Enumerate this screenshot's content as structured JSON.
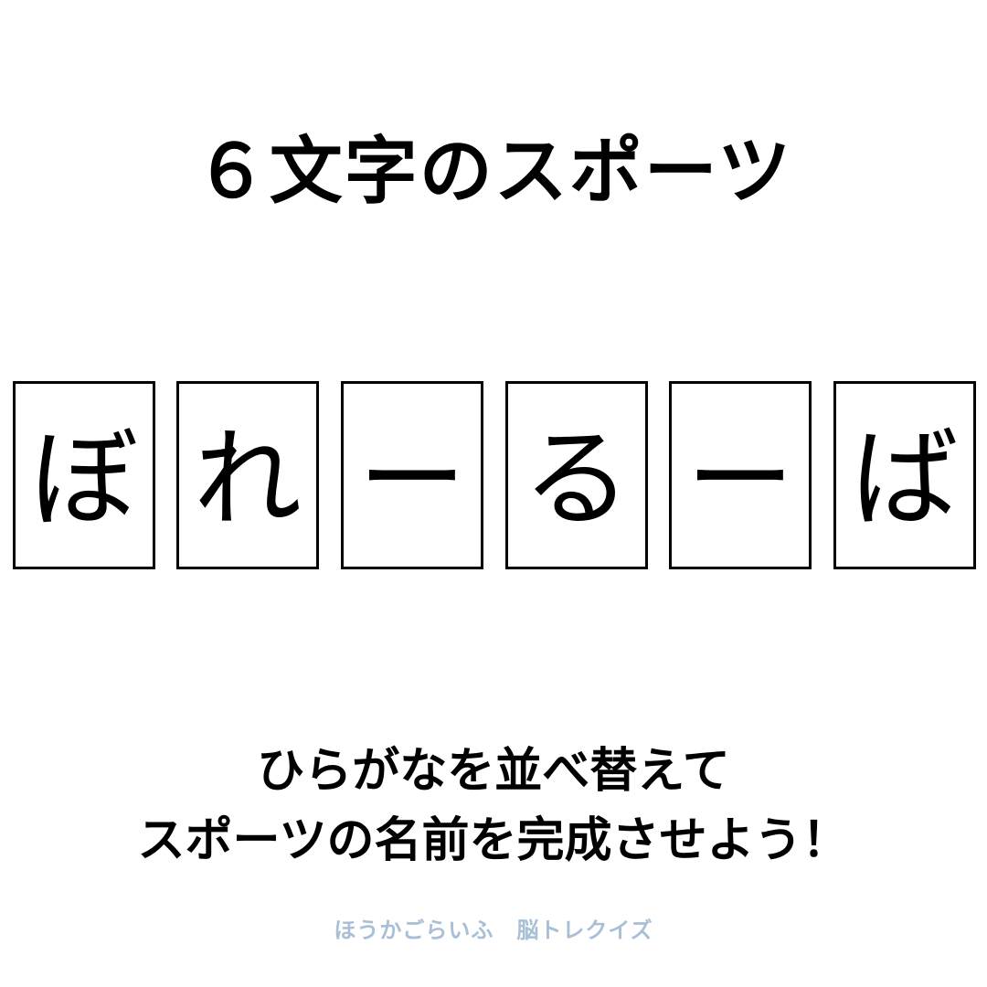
{
  "title": "６文字のスポーツ",
  "tiles": [
    {
      "char": "ぼ"
    },
    {
      "char": "れ"
    },
    {
      "char": "ー"
    },
    {
      "char": "る"
    },
    {
      "char": "ー"
    },
    {
      "char": "ば"
    }
  ],
  "instructions": {
    "line1": "ひらがなを並べ替えて",
    "line2": "スポーツの名前を完成させよう！"
  },
  "footer": "ほうかごらいふ　脳トレクイズ",
  "colors": {
    "text": "#000000",
    "footer": "#a9bfd6",
    "background": "#ffffff"
  }
}
